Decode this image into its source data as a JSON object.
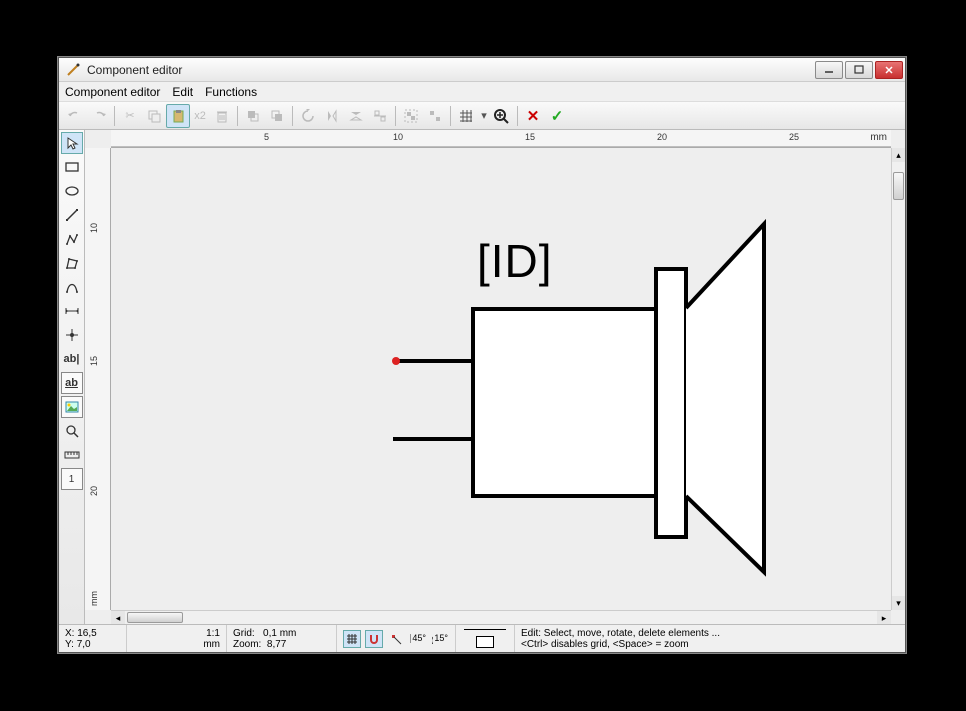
{
  "window": {
    "title": "Component editor"
  },
  "menu": {
    "editor": "Component editor",
    "edit": "Edit",
    "functions": "Functions"
  },
  "toolbar": {
    "duplicate_label": "x2"
  },
  "ruler": {
    "unit": "mm",
    "h_ticks": [
      "5",
      "10",
      "15",
      "20",
      "25"
    ],
    "v_ticks": [
      "10",
      "15",
      "20"
    ]
  },
  "canvas": {
    "component_id_label": "[ID]"
  },
  "status": {
    "x_label": "X:",
    "x_value": "16,5",
    "y_label": "Y:",
    "y_value": "7,0",
    "ratio": "1:1",
    "ratio_unit": "mm",
    "grid_label": "Grid:",
    "grid_value": "0,1 mm",
    "zoom_label": "Zoom:",
    "zoom_value": "8,77",
    "angle45": "45°",
    "angle15": "15°",
    "help1": "Edit: Select, move, rotate, delete elements ...",
    "help2": "<Ctrl> disables grid, <Space> = zoom"
  },
  "tooldock": {
    "text_label_a": "ab|",
    "text_label_b": "ab",
    "frame_label": "1"
  }
}
